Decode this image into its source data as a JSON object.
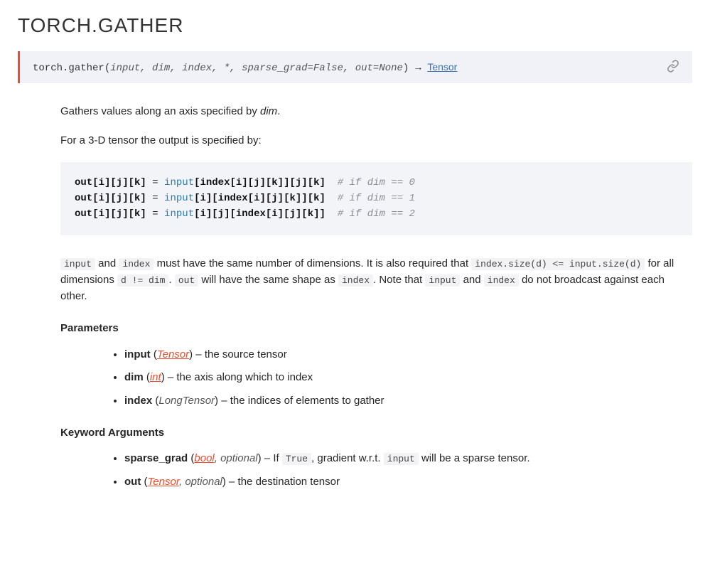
{
  "title": "TORCH.GATHER",
  "signature": {
    "qual": "torch.",
    "name": "gather",
    "params": "input, dim, index, *, sparse_grad=False, out=None",
    "returns": "Tensor"
  },
  "intro": {
    "text_before": "Gathers values along an axis specified by ",
    "dim": "dim",
    "text_after": "."
  },
  "for3d": "For a 3-D tensor the output is specified by:",
  "code": {
    "l1_a": "out[i][j][k]",
    "l1_eq": " = ",
    "l1_kw": "input",
    "l1_b": "[index[i][j][k]][j][k]",
    "l1_cm": "  # if dim == 0",
    "l2_a": "out[i][j][k]",
    "l2_eq": " = ",
    "l2_kw": "input",
    "l2_b": "[i][index[i][j][k]][k]",
    "l2_cm": "  # if dim == 1",
    "l3_a": "out[i][j][k]",
    "l3_eq": " = ",
    "l3_kw": "input",
    "l3_b": "[i][j][index[i][j][k]]",
    "l3_cm": "  # if dim == 2"
  },
  "note": {
    "c1": "input",
    "t1": " and ",
    "c2": "index",
    "t2": " must have the same number of dimensions. It is also required that ",
    "c3": "index.size(d) <= input.size(d)",
    "t3": " for all dimensions ",
    "c4": "d != dim",
    "t4": ". ",
    "c5": "out",
    "t5": " will have the same shape as ",
    "c6": "index",
    "t6": ". Note that ",
    "c7": "input",
    "t7": " and ",
    "c8": "index",
    "t8": " do not broadcast against each other."
  },
  "parameters_label": "Parameters",
  "params": {
    "p1": {
      "name": "input",
      "type": "Tensor",
      "desc": " – the source tensor"
    },
    "p2": {
      "name": "dim",
      "type": "int",
      "desc": " – the axis along which to index"
    },
    "p3": {
      "name": "index",
      "type": "LongTensor",
      "desc": " – the indices of elements to gather"
    }
  },
  "kwargs_label": "Keyword Arguments",
  "kwargs": {
    "k1": {
      "name": "sparse_grad",
      "type_link": "bool",
      "type_extra": ", optional",
      "desc_before": " – If ",
      "code": "True",
      "desc_mid": ", gradient w.r.t. ",
      "code2": "input",
      "desc_after": " will be a sparse tensor."
    },
    "k2": {
      "name": "out",
      "type_link": "Tensor",
      "type_extra": ", optional",
      "desc": " – the destination tensor"
    }
  }
}
